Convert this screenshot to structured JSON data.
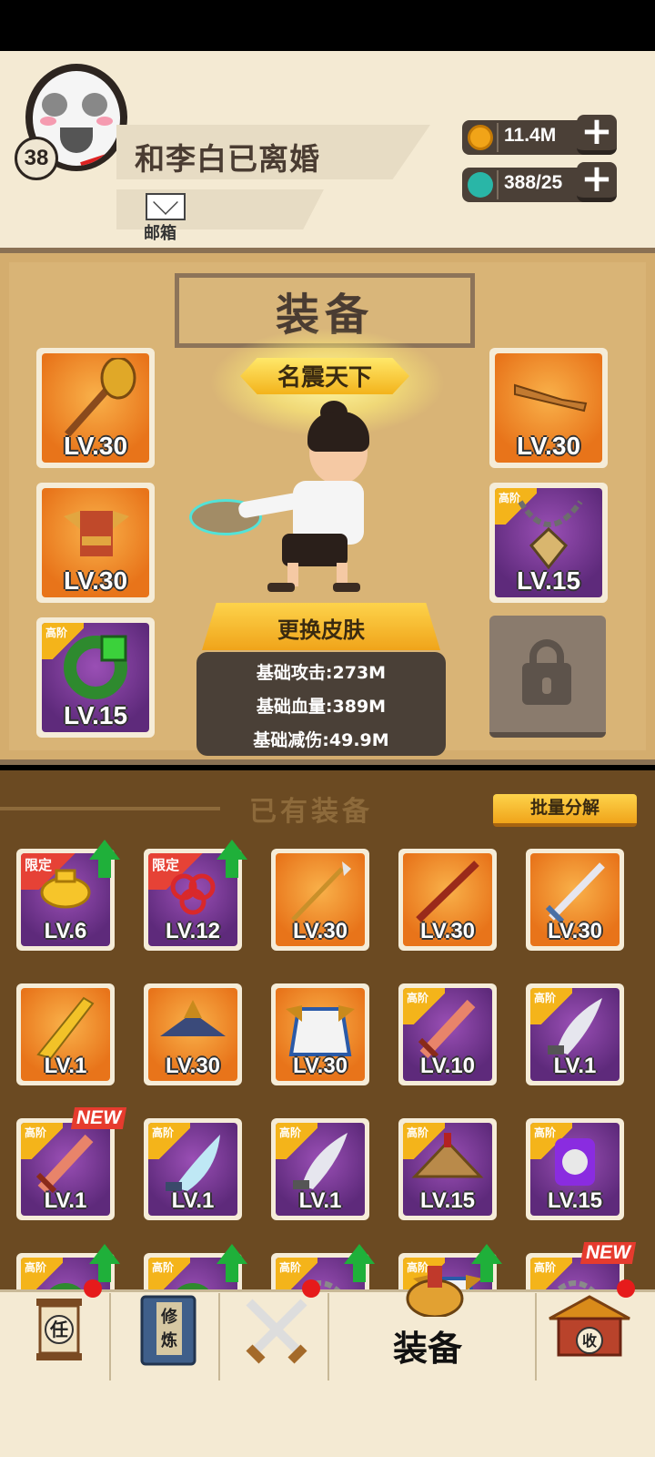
{
  "player": {
    "name": "和李白已离婚",
    "level": "38",
    "mail_label": "邮箱"
  },
  "currency": {
    "gold": "11.4M",
    "energy": "388/25"
  },
  "equipment_panel": {
    "title": "装备",
    "fame_title": "名震天下",
    "change_skin_label": "更换皮肤",
    "stats": [
      "基础攻击:273M",
      "基础血量:389M",
      "基础减伤:49.9M"
    ],
    "slots": [
      {
        "level": "LV.30",
        "tag": "",
        "color": "orange",
        "icon": "mace-icon"
      },
      {
        "level": "LV.30",
        "tag": "",
        "color": "orange",
        "icon": "armor-icon"
      },
      {
        "level": "LV.15",
        "tag": "高阶",
        "color": "purple",
        "icon": "jade-ring-icon"
      },
      {
        "level": "LV.30",
        "tag": "",
        "color": "orange",
        "icon": "boots-icon"
      },
      {
        "level": "LV.15",
        "tag": "高阶",
        "color": "purple",
        "icon": "amulet-icon"
      }
    ]
  },
  "inventory": {
    "title": "已有装备",
    "batch_button": "批量分解",
    "items": [
      {
        "level": "LV.6",
        "tag": "限定",
        "color": "purple",
        "icon": "gold-ingot-icon",
        "upgrade": true,
        "new": false
      },
      {
        "level": "LV.12",
        "tag": "限定",
        "color": "purple",
        "icon": "chinese-knot-icon",
        "upgrade": true,
        "new": false
      },
      {
        "level": "LV.30",
        "tag": "",
        "color": "orange",
        "icon": "spear-icon",
        "upgrade": false,
        "new": false
      },
      {
        "level": "LV.30",
        "tag": "",
        "color": "orange",
        "icon": "staff-icon",
        "upgrade": false,
        "new": false
      },
      {
        "level": "LV.30",
        "tag": "",
        "color": "orange",
        "icon": "sword-icon",
        "upgrade": false,
        "new": false
      },
      {
        "level": "LV.1",
        "tag": "",
        "color": "orange",
        "icon": "golden-blade-icon",
        "upgrade": false,
        "new": false
      },
      {
        "level": "LV.30",
        "tag": "",
        "color": "orange",
        "icon": "hat-icon",
        "upgrade": false,
        "new": false
      },
      {
        "level": "LV.30",
        "tag": "",
        "color": "orange",
        "icon": "robe-icon",
        "upgrade": false,
        "new": false
      },
      {
        "level": "LV.10",
        "tag": "高阶",
        "color": "purple",
        "icon": "wooden-sword-icon",
        "upgrade": false,
        "new": false
      },
      {
        "level": "LV.1",
        "tag": "高阶",
        "color": "purple",
        "icon": "machete-icon",
        "upgrade": false,
        "new": false
      },
      {
        "level": "LV.1",
        "tag": "高阶",
        "color": "purple",
        "icon": "wooden-sword-icon",
        "upgrade": false,
        "new": true
      },
      {
        "level": "LV.1",
        "tag": "高阶",
        "color": "purple",
        "icon": "curved-blade-icon",
        "upgrade": false,
        "new": false
      },
      {
        "level": "LV.1",
        "tag": "高阶",
        "color": "purple",
        "icon": "machete-icon",
        "upgrade": false,
        "new": false
      },
      {
        "level": "LV.15",
        "tag": "高阶",
        "color": "purple",
        "icon": "straw-hat-icon",
        "upgrade": false,
        "new": false
      },
      {
        "level": "LV.15",
        "tag": "高阶",
        "color": "purple",
        "icon": "pendant-icon",
        "upgrade": false,
        "new": false
      },
      {
        "level": "",
        "tag": "高阶",
        "color": "purple",
        "icon": "ring-icon",
        "upgrade": true,
        "new": false
      },
      {
        "level": "",
        "tag": "高阶",
        "color": "purple",
        "icon": "ring-icon",
        "upgrade": true,
        "new": false
      },
      {
        "level": "",
        "tag": "高阶",
        "color": "purple",
        "icon": "chain-icon",
        "upgrade": true,
        "new": false
      },
      {
        "level": "",
        "tag": "高阶",
        "color": "purple",
        "icon": "robe-icon",
        "upgrade": true,
        "new": false
      },
      {
        "level": "",
        "tag": "高阶",
        "color": "purple",
        "icon": "chain-icon",
        "upgrade": false,
        "new": true
      }
    ]
  },
  "new_badge": "NEW",
  "nav": {
    "tasks_char": "任",
    "cultivate_chars": [
      "修",
      "炼"
    ],
    "equipment_label": "装备",
    "collect_char": "收"
  }
}
